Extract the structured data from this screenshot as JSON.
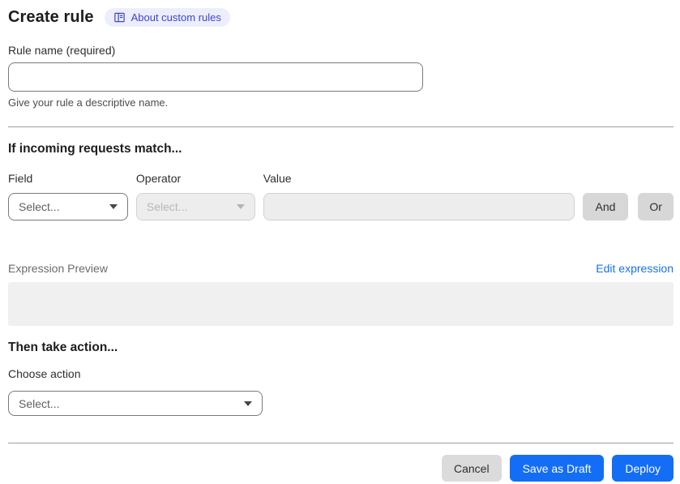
{
  "header": {
    "title": "Create rule",
    "about_link": {
      "label": "About custom rules",
      "icon": "book-icon"
    }
  },
  "rule_name": {
    "label": "Rule name (required)",
    "value": "",
    "helper_text": "Give your rule a descriptive name."
  },
  "match": {
    "heading": "If incoming requests match...",
    "columns": {
      "field": "Field",
      "operator": "Operator",
      "value": "Value"
    },
    "field_select": {
      "value": "Select...",
      "disabled": false
    },
    "operator_select": {
      "value": "Select...",
      "disabled": true
    },
    "value_input": {
      "value": "",
      "disabled": true
    },
    "and_label": "And",
    "or_label": "Or"
  },
  "expression": {
    "label": "Expression Preview",
    "edit_link": "Edit expression",
    "preview": ""
  },
  "action": {
    "heading": "Then take action...",
    "label": "Choose action",
    "select_value": "Select..."
  },
  "footer": {
    "cancel_label": "Cancel",
    "save_draft_label": "Save as Draft",
    "deploy_label": "Deploy"
  },
  "colors": {
    "primary_button": "#136ef5",
    "link_blue": "#1672ec",
    "badge_bg": "#eceefb",
    "badge_text": "#3c46ce",
    "disabled_fill": "#ededed",
    "neutral_button": "#d7d7d7",
    "preview_box_bg": "#f0f0f0",
    "divider": "#9d9d9d"
  }
}
